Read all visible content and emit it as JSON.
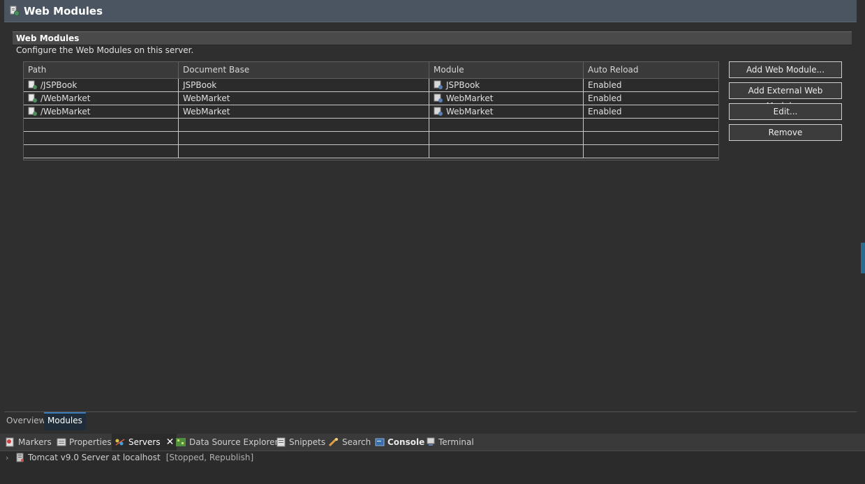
{
  "editor": {
    "title": "Web Modules",
    "section_title": "Web Modules",
    "section_description": "Configure the Web Modules on this server."
  },
  "table": {
    "columns": [
      "Path",
      "Document Base",
      "Module",
      "Auto Reload"
    ],
    "rows": [
      {
        "path": "/JSPBook",
        "document_base": "JSPBook",
        "module": "JSPBook",
        "auto_reload": "Enabled"
      },
      {
        "path": "/WebMarket",
        "document_base": "WebMarket",
        "module": "WebMarket",
        "auto_reload": "Enabled"
      },
      {
        "path": "/WebMarket",
        "document_base": "WebMarket",
        "module": "WebMarket",
        "auto_reload": "Enabled"
      }
    ]
  },
  "buttons": {
    "add_web_module": "Add Web Module...",
    "add_external_web_module": "Add External Web Module...",
    "edit": "Edit...",
    "remove": "Remove"
  },
  "page_tabs": [
    "Overview",
    "Modules"
  ],
  "view_tabs": [
    "Markers",
    "Properties",
    "Servers",
    "Data Source Explorer",
    "Snippets",
    "Search",
    "Console",
    "Terminal"
  ],
  "servers": {
    "name": "Tomcat v9.0 Server at localhost",
    "status": "[Stopped, Republish]"
  },
  "colors": {
    "title_bar": "#4a5561",
    "active_tab": "#1f2d3a",
    "accent": "#3d7ab8"
  }
}
